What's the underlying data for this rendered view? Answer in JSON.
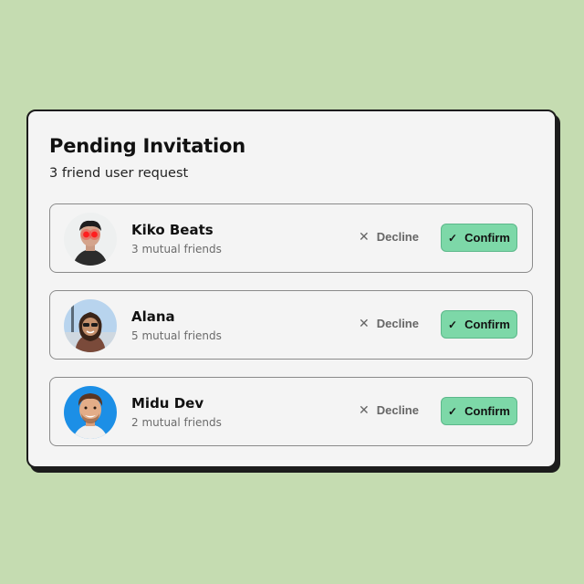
{
  "header": {
    "title": "Pending Invitation",
    "subtitle": "3 friend user request"
  },
  "requests": [
    {
      "name": "Kiko Beats",
      "mutual": "3 mutual friends",
      "avatar": "avatar-kiko",
      "decline_label": "Decline",
      "confirm_label": "Confirm"
    },
    {
      "name": "Alana",
      "mutual": "5 mutual friends",
      "avatar": "avatar-alana",
      "decline_label": "Decline",
      "confirm_label": "Confirm"
    },
    {
      "name": "Midu Dev",
      "mutual": "2 mutual friends",
      "avatar": "avatar-midu",
      "decline_label": "Decline",
      "confirm_label": "Confirm"
    }
  ],
  "icons": {
    "decline": "close-icon",
    "confirm": "check-icon"
  },
  "colors": {
    "background": "#c5dcb1",
    "card": "#f4f4f4",
    "confirm": "#7dd8a8",
    "border": "#1c1c1c"
  }
}
